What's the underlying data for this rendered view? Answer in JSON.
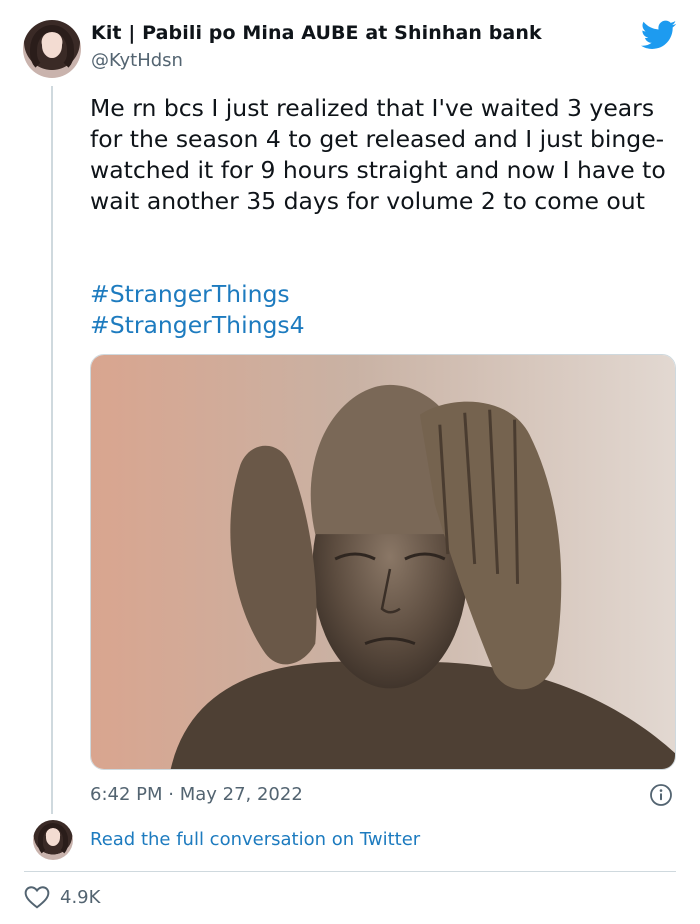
{
  "author": {
    "display_name": "Kit | Pabili po Mina AUBE at Shinhan bank",
    "handle": "@KytHdsn"
  },
  "tweet": {
    "text": "Me rn bcs I just realized that I've waited 3 years for the season 4 to get released and I just binge-watched it for 9 hours straight and now I have to wait another 35 days for volume 2 to come out",
    "hashtags": [
      "#StrangerThings",
      "#StrangerThings4"
    ],
    "timestamp": "6:42 PM · May 27, 2022"
  },
  "footer": {
    "read_more_label": "Read the full conversation on Twitter",
    "like_count": "4.9K"
  },
  "icons": {
    "brand": "twitter-bird-icon",
    "info": "info-icon",
    "like": "heart-icon"
  },
  "colors": {
    "twitter_blue": "#1d9bf0",
    "link": "#1d7bbf",
    "muted": "#536471"
  }
}
